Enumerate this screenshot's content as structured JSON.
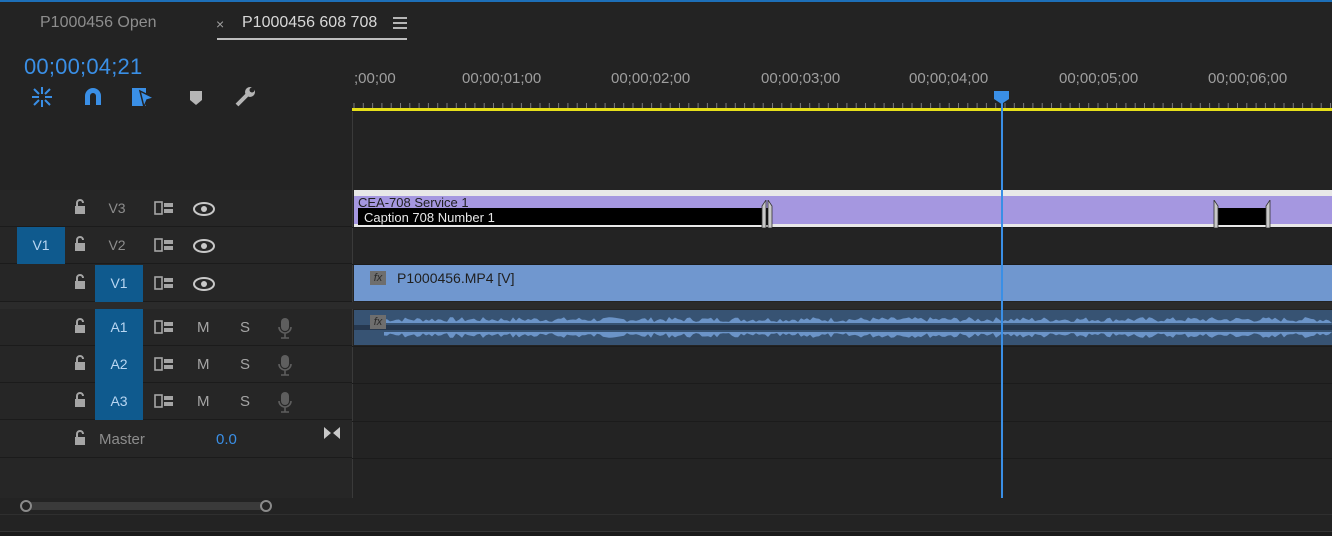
{
  "tabs": [
    {
      "label": "P1000456 Open",
      "active": false
    },
    {
      "label": "P1000456 608 708",
      "active": true,
      "close": "×"
    }
  ],
  "timecode": "00;00;04;21",
  "tools": [
    "insert-and-overwrite-nest-icon",
    "snap-magnet-icon",
    "linked-selection-icon",
    "add-marker-icon",
    "wrench-settings-icon"
  ],
  "ruler": {
    "labels": [
      ";00;00",
      "00;00;01;00",
      "00;00;02;00",
      "00;00;03;00",
      "00;00;04;00",
      "00;00;05;00",
      "00;00;06;00"
    ]
  },
  "tracks": {
    "v3": {
      "name": "V3"
    },
    "v2": {
      "name": "V2",
      "source": "V1"
    },
    "v1": {
      "name": "V1"
    },
    "a1": {
      "name": "A1",
      "m": "M",
      "s": "S"
    },
    "a2": {
      "name": "A2",
      "m": "M",
      "s": "S"
    },
    "a3": {
      "name": "A3",
      "m": "M",
      "s": "S"
    },
    "master": {
      "name": "Master",
      "value": "0.0"
    }
  },
  "clips": {
    "caption_service": "CEA-708 Service 1",
    "caption_item": "Caption 708 Number 1",
    "video": "P1000456.MP4 [V]",
    "fx": "fx"
  },
  "colors": {
    "accent": "#3a8fe6",
    "caption": "#a597e0",
    "video": "#7097cf",
    "audio": "#375373",
    "workarea": "#e6df1a",
    "target": "#0f5a8e"
  }
}
